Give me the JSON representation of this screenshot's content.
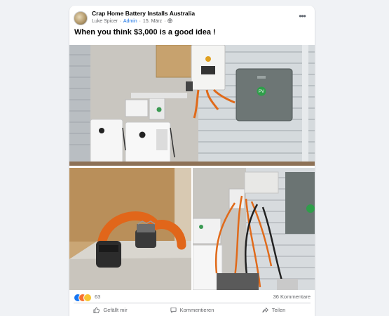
{
  "post": {
    "group_name": "Crap Home Battery Installs Australia",
    "author": "Luke Spicer",
    "role": "Admin",
    "date": "15. März",
    "separator": "·",
    "text": "When you think $3,000 is a good idea !"
  },
  "photos": [
    {
      "badge": "PV"
    },
    {},
    {}
  ],
  "stats": {
    "reaction_count": "63",
    "comments": "36 Kommentare"
  },
  "actions": {
    "like": "Gefällt mir",
    "comment": "Kommentieren",
    "share": "Teilen"
  },
  "icons": {
    "more": "more-options-icon",
    "privacy": "globe-icon",
    "like": "thumbs-up-icon",
    "comment": "comment-bubble-icon",
    "share": "share-arrow-icon"
  },
  "colors": {
    "accent": "#1877f2",
    "admin_badge": "#1b74e4",
    "secondary_text": "#65676b"
  }
}
